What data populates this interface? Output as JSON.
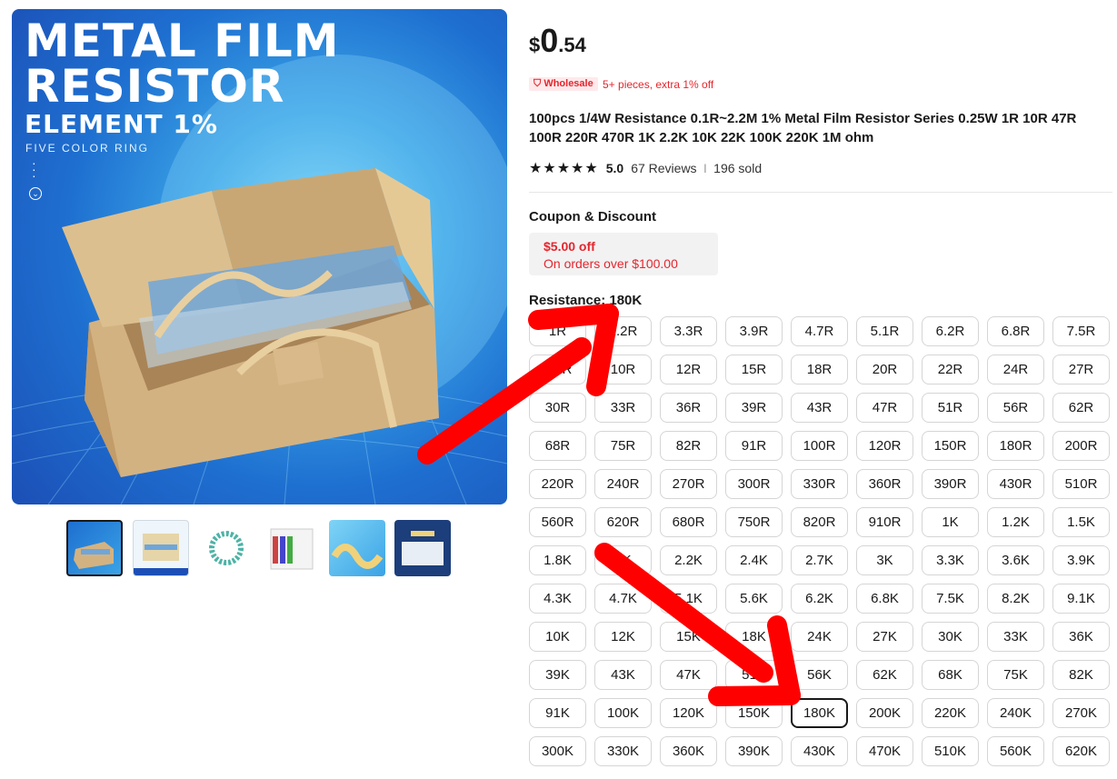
{
  "hero": {
    "line1": "METAL FILM",
    "line2": "RESISTOR",
    "line3": "ELEMENT 1%",
    "line4": "FIVE COLOR RING"
  },
  "thumbnails": [
    "thumb-1",
    "thumb-2",
    "thumb-3",
    "thumb-4",
    "thumb-5",
    "thumb-6"
  ],
  "price": {
    "currency": "$",
    "integer": "0",
    "decimal": ".54"
  },
  "wholesale": {
    "badge": "Wholesale",
    "note": "5+ pieces, extra 1% off"
  },
  "title": "100pcs 1/4W Resistance 0.1R~2.2M 1% Metal Film Resistor Series 0.25W 1R 10R 47R 100R 220R 470R 1K 2.2K 10K 22K 100K 220K 1M ohm",
  "rating": {
    "stars": "★★★★★",
    "score": "5.0",
    "reviews": "67 Reviews",
    "separator": "|",
    "sold": "196 sold"
  },
  "coupon": {
    "heading": "Coupon & Discount",
    "amount": "$5.00 off",
    "condition": "On orders over $100.00"
  },
  "resistance": {
    "heading": "Resistance: 180K",
    "selected": "180K",
    "options": [
      "1R",
      "2.2R",
      "3.3R",
      "3.9R",
      "4.7R",
      "5.1R",
      "6.2R",
      "6.8R",
      "7.5R",
      "8.2R",
      "10R",
      "12R",
      "15R",
      "18R",
      "20R",
      "22R",
      "24R",
      "27R",
      "30R",
      "33R",
      "36R",
      "39R",
      "43R",
      "47R",
      "51R",
      "56R",
      "62R",
      "68R",
      "75R",
      "82R",
      "91R",
      "100R",
      "120R",
      "150R",
      "180R",
      "200R",
      "220R",
      "240R",
      "270R",
      "300R",
      "330R",
      "360R",
      "390R",
      "430R",
      "510R",
      "560R",
      "620R",
      "680R",
      "750R",
      "820R",
      "910R",
      "1K",
      "1.2K",
      "1.5K",
      "1.8K",
      "2K",
      "2.2K",
      "2.4K",
      "2.7K",
      "3K",
      "3.3K",
      "3.6K",
      "3.9K",
      "4.3K",
      "4.7K",
      "5.1K",
      "5.6K",
      "6.2K",
      "6.8K",
      "7.5K",
      "8.2K",
      "9.1K",
      "10K",
      "12K",
      "15K",
      "18K",
      "24K",
      "27K",
      "30K",
      "33K",
      "36K",
      "39K",
      "43K",
      "47K",
      "51K",
      "56K",
      "62K",
      "68K",
      "75K",
      "82K",
      "91K",
      "100K",
      "120K",
      "150K",
      "180K",
      "200K",
      "220K",
      "240K",
      "270K",
      "300K",
      "330K",
      "360K",
      "390K",
      "430K",
      "470K",
      "510K",
      "560K",
      "620K"
    ]
  },
  "colors": {
    "accent_red": "#e4262e",
    "arrow_red": "#ff0000",
    "selected_border": "#191919"
  }
}
